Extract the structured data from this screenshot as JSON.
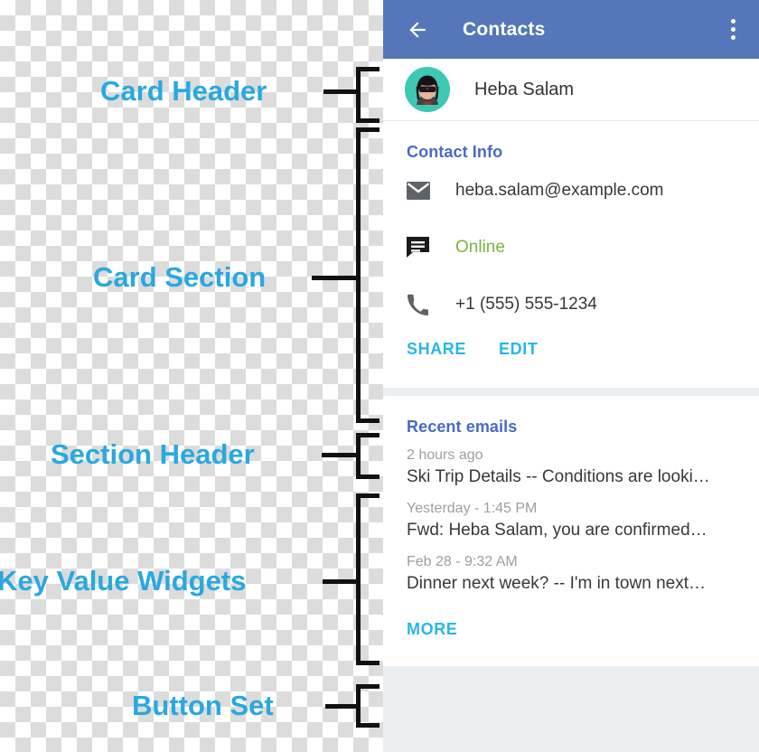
{
  "annotations": [
    {
      "label": "Card Header",
      "name": "card-header"
    },
    {
      "label": "Card Section",
      "name": "card-section"
    },
    {
      "label": "Section Header",
      "name": "section-header"
    },
    {
      "label": "Key Value Widgets",
      "name": "key-value-widgets"
    },
    {
      "label": "Button Set",
      "name": "button-set"
    }
  ],
  "colors": {
    "annotation": "#29a8e0",
    "appbar": "#5577b9",
    "section_title": "#4a69c8",
    "flat_button": "#29b6e8",
    "online_status": "#7cb342",
    "avatar_bg": "#3dc8b4"
  },
  "appbar": {
    "back_icon": "arrow-left-icon",
    "title": "Contacts",
    "overflow_icon": "more-vert-icon"
  },
  "card_header": {
    "avatar_icon": "avatar",
    "name": "Heba Salam"
  },
  "contact_info": {
    "title": "Contact Info",
    "rows": [
      {
        "icon": "email-icon",
        "value": "heba.salam@example.com",
        "state": "normal"
      },
      {
        "icon": "chat-icon",
        "value": "Online",
        "state": "online"
      },
      {
        "icon": "phone-icon",
        "value": "+1 (555) 555-1234",
        "state": "normal"
      }
    ],
    "buttons": [
      {
        "label": "SHARE"
      },
      {
        "label": "EDIT"
      }
    ]
  },
  "recent_emails": {
    "title": "Recent emails",
    "items": [
      {
        "time": "2 hours ago",
        "subject": "Ski Trip Details -- Conditions are looki…"
      },
      {
        "time": "Yesterday - 1:45 PM",
        "subject": "Fwd: Heba Salam, you are confirmed…"
      },
      {
        "time": "Feb 28 - 9:32 AM",
        "subject": "Dinner next week? -- I'm in town next…"
      }
    ],
    "buttons": [
      {
        "label": "MORE"
      }
    ]
  }
}
